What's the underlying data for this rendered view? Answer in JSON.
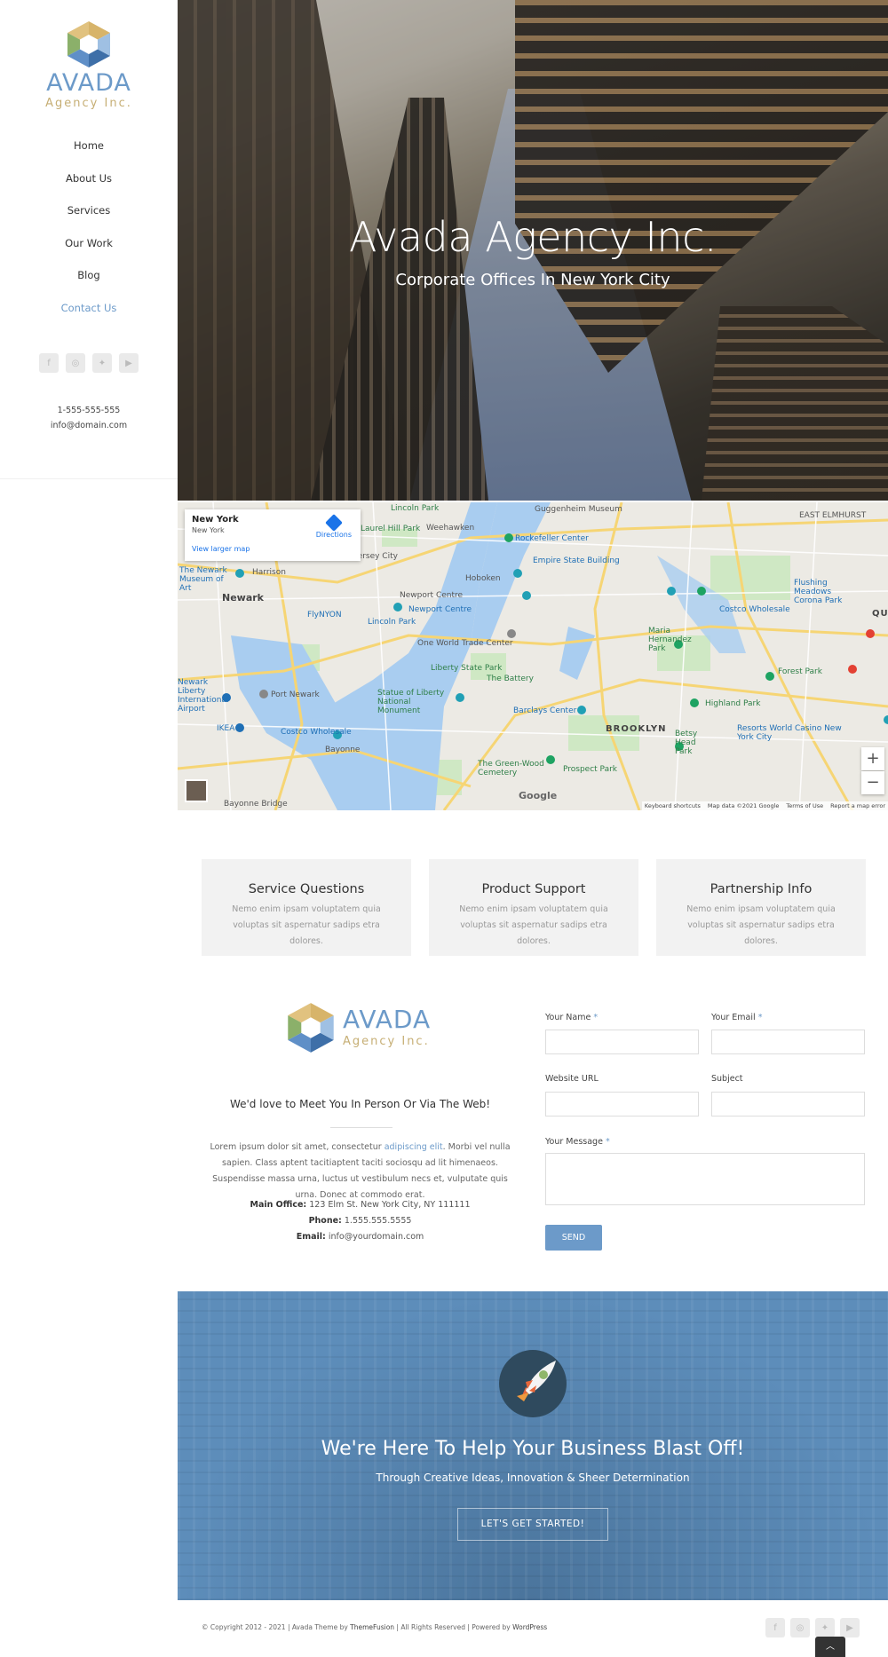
{
  "brand": {
    "name": "AVADA",
    "tagline": "Agency Inc."
  },
  "nav": {
    "items": [
      "Home",
      "About Us",
      "Services",
      "Our Work",
      "Blog",
      "Contact Us"
    ],
    "active": "Contact Us"
  },
  "social_icons": [
    "facebook-icon",
    "instagram-icon",
    "twitter-icon",
    "youtube-icon"
  ],
  "sidebar_contact": {
    "phone": "1-555-555-555",
    "email": "info@domain.com"
  },
  "hero": {
    "title": "Avada Agency Inc.",
    "subtitle": "Corporate Offices In New York City"
  },
  "map": {
    "card": {
      "title": "New York",
      "subtitle": "New York",
      "link": "View larger map",
      "directions": "Directions"
    },
    "labels": [
      "Guggenheim Museum",
      "Weehawken",
      "Lincoln Park",
      "Laurel Hill Park",
      "Rockefeller Center",
      "Empire State Building",
      "The Newark Museum of Art",
      "Harrison",
      "Newark",
      "Hoboken",
      "Newport Centre",
      "Lincoln Park",
      "One World Trade Center",
      "Costco Wholesale",
      "Flushing Meadows Corona Park",
      "Maria Hernandez Park",
      "Forest Park",
      "Newark Liberty International Airport",
      "Port Newark",
      "Liberty State Park",
      "Statue of Liberty National Monument",
      "The Battery",
      "Barclays Center",
      "Highland Park",
      "IKEA",
      "Costco Wholesale",
      "Bayonne",
      "BROOKLYN",
      "Betsy Head Park",
      "Resorts World Casino New York City",
      "The Green-Wood Cemetery",
      "Prospect Park",
      "Bayonne Bridge",
      "EAST ELMHURST",
      "QUE",
      "Newport Centre",
      "FlyNYON",
      "Jersey City"
    ],
    "footer": [
      "Keyboard shortcuts",
      "Map data ©2021 Google",
      "Terms of Use",
      "Report a map error"
    ],
    "google": "Google",
    "zoom_in": "+",
    "zoom_out": "−"
  },
  "info_boxes": [
    {
      "title": "Service Questions",
      "text": "Nemo enim ipsam voluptatem quia voluptas sit aspernatur sadips etra dolores."
    },
    {
      "title": "Product Support",
      "text": "Nemo enim ipsam voluptatem quia voluptas sit aspernatur sadips etra dolores."
    },
    {
      "title": "Partnership Info",
      "text": "Nemo enim ipsam voluptatem quia voluptas sit aspernatur sadips etra dolores."
    }
  ],
  "contact": {
    "heading": "We'd love to Meet You In Person  Or Via The Web!",
    "para_1": "Lorem ipsum dolor sit amet, consectetur ",
    "para_link": "adipiscing elit",
    "para_2": ". Morbi vel nulla sapien. Class aptent tacitiaptent taciti sociosqu ad lit himenaeos. Suspendisse massa urna, luctus ut vestibulum necs et, vulputate quis urna. Donec at commodo erat.",
    "office_label": "Main Office:",
    "office": "123 Elm St. New York City, NY 111111",
    "phone_label": "Phone:",
    "phone": "1.555.555.5555",
    "email_label": "Email:",
    "email": "info@yourdomain.com"
  },
  "form": {
    "name_label": "Your Name",
    "email_label": "Your Email",
    "url_label": "Website URL",
    "subject_label": "Subject",
    "message_label": "Your Message",
    "required": "*",
    "send": "SEND"
  },
  "cta": {
    "title": "We're Here To Help Your Business Blast Off!",
    "subtitle": "Through Creative Ideas, Innovation & Sheer Determination",
    "button": "LET'S GET STARTED!"
  },
  "footer": {
    "text_1": "© Copyright 2012 - 2021 | Avada Theme by ",
    "link_1": "ThemeFusion",
    "text_2": " | All Rights Reserved | Powered by ",
    "link_2": "WordPress"
  },
  "to_top_icon": "chevron-up-icon"
}
